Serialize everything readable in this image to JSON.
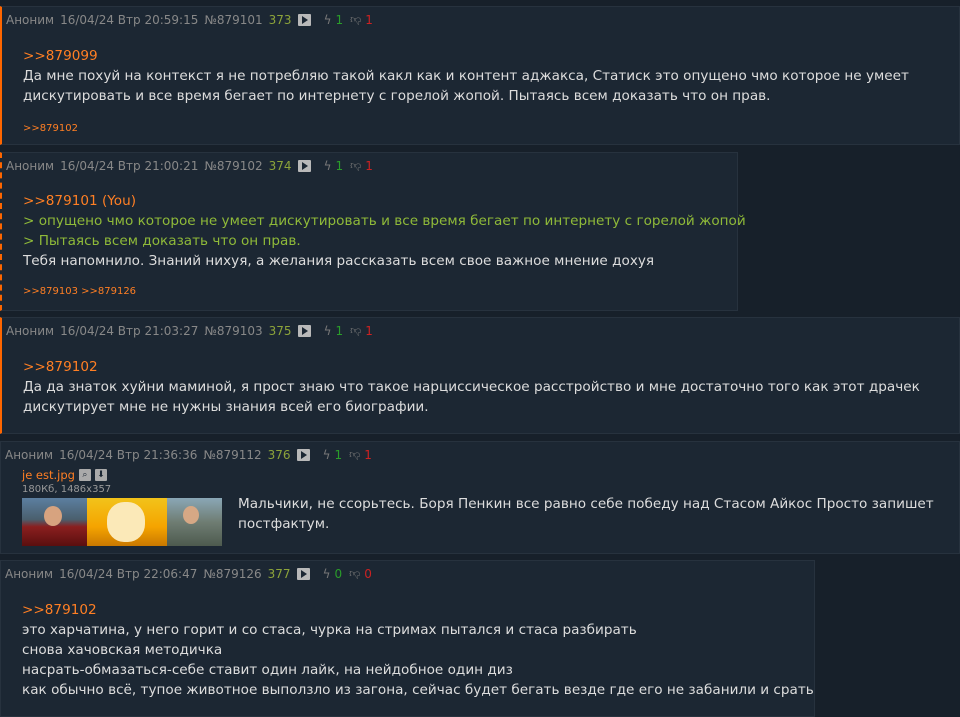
{
  "posts": [
    {
      "name": "Аноним",
      "date": "16/04/24 Втр 20:59:15",
      "number": "№879101",
      "index": "373",
      "likes": "1",
      "dislikes": "1",
      "reply_link": ">>879099",
      "lines": [
        "Да мне похуй на контекст я не потребляю такой какл как и контент аджакса, Статиск это опущено чмо которое не умеет",
        "дискутировать и все время бегает по интернету с горелой жопой. Пытаясь всем доказать что он прав."
      ],
      "replies": ">>879102"
    },
    {
      "name": "Аноним",
      "date": "16/04/24 Втр 21:00:21",
      "number": "№879102",
      "index": "374",
      "likes": "1",
      "dislikes": "1",
      "reply_link": ">>879101 (You)",
      "quotes": [
        "> опущено чмо которое не умеет дискутировать и все время бегает по интернету с горелой жопой",
        "> Пытаясь всем доказать что он прав."
      ],
      "lines": [
        "Тебя напомнило. Знаний нихуя, а желания рассказать всем свое важное мнение дохуя"
      ],
      "replies": ">>879103 >>879126"
    },
    {
      "name": "Аноним",
      "date": "16/04/24 Втр 21:03:27",
      "number": "№879103",
      "index": "375",
      "likes": "1",
      "dislikes": "1",
      "reply_link": ">>879102",
      "lines": [
        "Да да знаток хуйни маминой, я прост знаю что такое нарциссическое расстройство и мне достаточно того как этот драчек",
        "дискутирует мне не нужны знания всей его биографии."
      ]
    },
    {
      "name": "Аноним",
      "date": "16/04/24 Втр 21:36:36",
      "number": "№879112",
      "index": "376",
      "likes": "1",
      "dislikes": "1",
      "file_name": "je est.jpg",
      "file_meta": "180Кб, 1486x357",
      "lines": [
        "Мальчики, не ссорьтесь. Боря Пенкин все равно себе победу над Стасом Айкос Просто запишет",
        "постфактум."
      ]
    },
    {
      "name": "Аноним",
      "date": "16/04/24 Втр 22:06:47",
      "number": "№879126",
      "index": "377",
      "likes": "0",
      "dislikes": "0",
      "reply_link": ">>879102",
      "lines": [
        "это харчатина, у него горит и со стаса, чурка на стримах пытался и стаса разбирать",
        "снова хачовская методичка",
        "насрать-обмазаться-себе ставит один лайк, на нейдобное один диз",
        "как обычно всё, тупое животное выползло из загона, сейчас будет бегать везде где его не забанили и срать"
      ]
    }
  ]
}
